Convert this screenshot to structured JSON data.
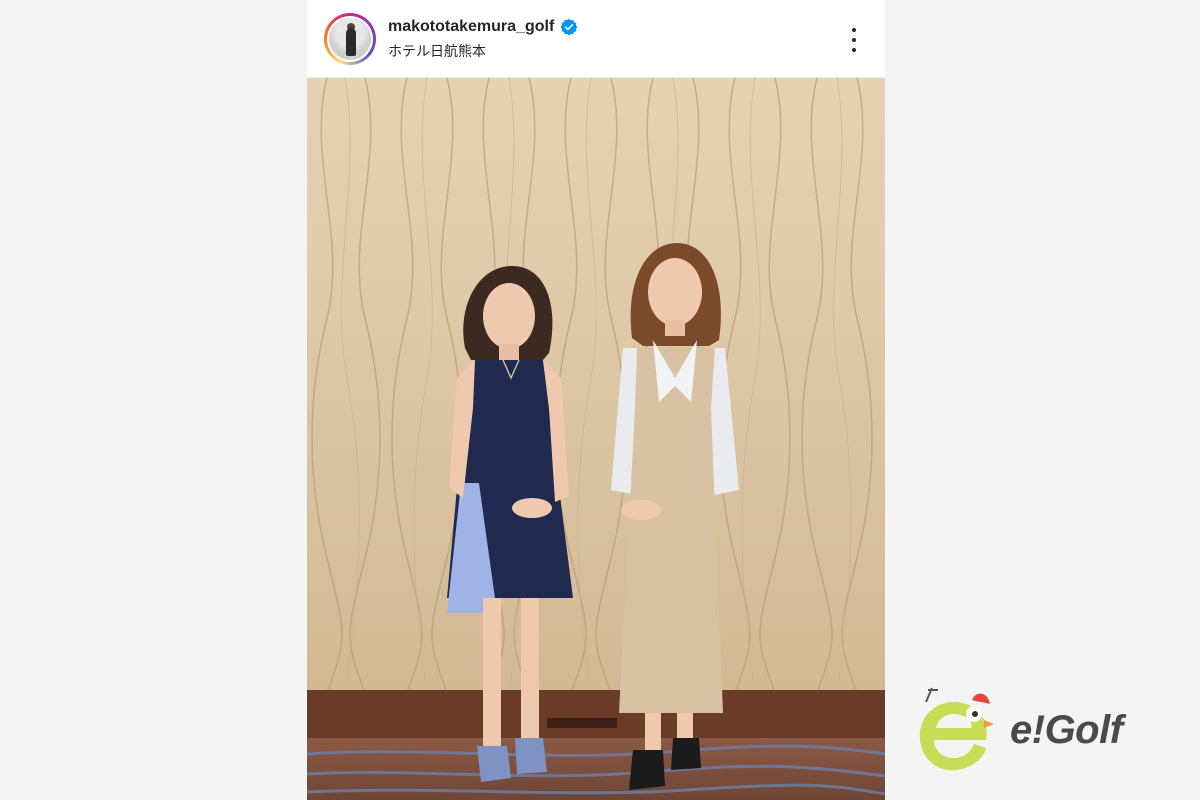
{
  "post": {
    "username": "makototakemura_golf",
    "verified": true,
    "location": "ホテル日航熊本",
    "more_icon": "more-vertical-icon"
  },
  "photo": {
    "subject_count": 2
  },
  "brand": {
    "logo_text": "e!Golf",
    "accent_color": "#c6dd55"
  },
  "colors": {
    "verified_blue": "#0095f6",
    "text": "#262626",
    "page_background": "#f4f4f4"
  }
}
